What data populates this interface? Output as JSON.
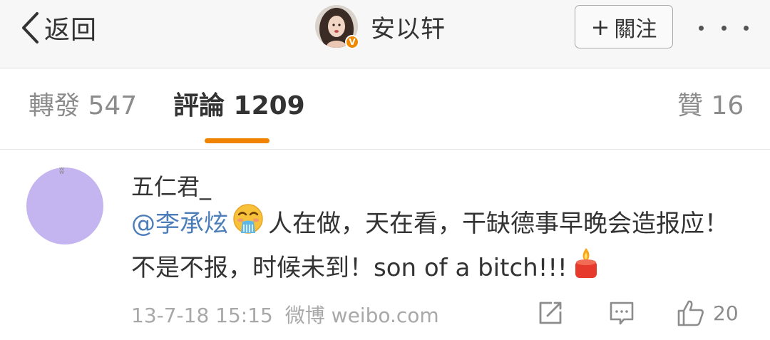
{
  "nav": {
    "back_label": "返回",
    "profile_name": "安以轩",
    "badge": "V",
    "follow_label": "關注",
    "follow_plus": "+"
  },
  "tabs": {
    "repost": "轉發 547",
    "comment": "評論 1209",
    "like": "贊 16"
  },
  "comment": {
    "username": "五仁君_",
    "mention": "@李承炫",
    "text_part1": "人在做，天在看，干缺德事早晚会造报应！不是不报，时候未到！son of a bitch!!!",
    "timestamp": "13-7-18 15:15",
    "source": "微博 weibo.com",
    "like_count": "20"
  },
  "colors": {
    "accent": "#f08300",
    "mention": "#4c7db9",
    "avatar_bg": "#c4b5f0"
  },
  "icons": [
    "chevron-left-icon",
    "more-dots-icon",
    "repost-icon",
    "comment-icon",
    "thumbs-up-icon",
    "candle-emoji",
    "vomit-emoji"
  ]
}
